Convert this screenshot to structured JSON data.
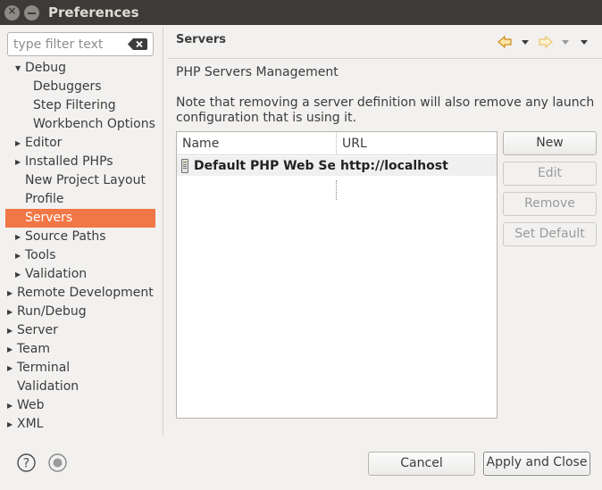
{
  "window": {
    "title": "Preferences"
  },
  "filter": {
    "placeholder": "type filter text"
  },
  "tree": [
    {
      "label": "Debug",
      "level": 1,
      "arrow": "expanded",
      "selected": false
    },
    {
      "label": "Debuggers",
      "level": 2,
      "arrow": "none",
      "selected": false
    },
    {
      "label": "Step Filtering",
      "level": 2,
      "arrow": "none",
      "selected": false
    },
    {
      "label": "Workbench Options",
      "level": 2,
      "arrow": "none",
      "selected": false
    },
    {
      "label": "Editor",
      "level": 1,
      "arrow": "collapsed",
      "selected": false
    },
    {
      "label": "Installed PHPs",
      "level": 1,
      "arrow": "collapsed",
      "selected": false
    },
    {
      "label": "New Project Layout",
      "level": 1,
      "arrow": "none",
      "selected": false
    },
    {
      "label": "Profile",
      "level": 1,
      "arrow": "none",
      "selected": false
    },
    {
      "label": "Servers",
      "level": 1,
      "arrow": "none",
      "selected": true
    },
    {
      "label": "Source Paths",
      "level": 1,
      "arrow": "collapsed",
      "selected": false
    },
    {
      "label": "Tools",
      "level": 1,
      "arrow": "collapsed",
      "selected": false
    },
    {
      "label": "Validation",
      "level": 1,
      "arrow": "collapsed",
      "selected": false
    },
    {
      "label": "Remote Development",
      "level": 0,
      "arrow": "collapsed",
      "selected": false
    },
    {
      "label": "Run/Debug",
      "level": 0,
      "arrow": "collapsed",
      "selected": false
    },
    {
      "label": "Server",
      "level": 0,
      "arrow": "collapsed",
      "selected": false
    },
    {
      "label": "Team",
      "level": 0,
      "arrow": "collapsed",
      "selected": false
    },
    {
      "label": "Terminal",
      "level": 0,
      "arrow": "collapsed",
      "selected": false
    },
    {
      "label": "Validation",
      "level": 0,
      "arrow": "none",
      "selected": false
    },
    {
      "label": "Web",
      "level": 0,
      "arrow": "collapsed",
      "selected": false
    },
    {
      "label": "XML",
      "level": 0,
      "arrow": "collapsed",
      "selected": false
    }
  ],
  "page": {
    "title": "Servers",
    "section": "PHP Servers Management",
    "note": "Note that removing a server definition will also remove any launch configuration that is using it."
  },
  "table": {
    "headers": {
      "name": "Name",
      "url": "URL"
    },
    "rows": [
      {
        "name": "Default PHP Web Server",
        "url": "http://localhost"
      }
    ]
  },
  "buttons": {
    "new": "New",
    "edit": "Edit",
    "remove": "Remove",
    "set_default": "Set Default"
  },
  "footer": {
    "cancel": "Cancel",
    "apply_close": "Apply and Close"
  },
  "icons": {
    "close": "close-icon",
    "minimize": "minimize-icon",
    "clear": "clear-filter-icon",
    "back": "back-arrow-icon",
    "forward": "forward-arrow-icon",
    "menu": "view-menu-icon",
    "server": "server-icon",
    "help": "help-icon",
    "record": "record-macro-icon"
  },
  "colors": {
    "selection": "#f07746",
    "titlebar": "#3c3b37",
    "nav_arrow": "#e8a33c"
  }
}
